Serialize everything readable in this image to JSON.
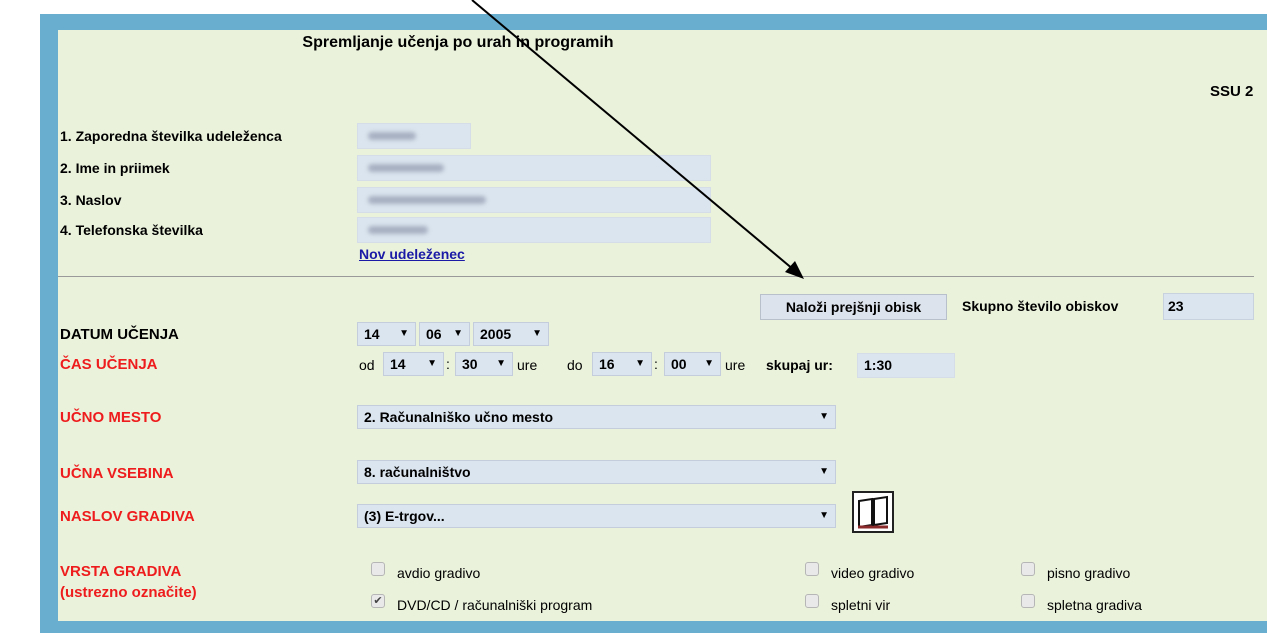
{
  "form": {
    "title": "Spremljanje učenja po urah in programih",
    "code": "SSU 2"
  },
  "participant": {
    "fields": [
      {
        "label": "1. Zaporedna številka udeleženca"
      },
      {
        "label": "2. Ime in priimek"
      },
      {
        "label": "3. Naslov"
      },
      {
        "label": "4. Telefonska številka"
      }
    ],
    "new_link": "Nov udeleženec"
  },
  "visits": {
    "load_button": "Naloži prejšnji obisk",
    "count_label": "Skupno število obiskov",
    "count_value": "23"
  },
  "date": {
    "label": "DATUM UČENJA",
    "day": "14",
    "month": "06",
    "year": "2005"
  },
  "time": {
    "label": "ČAS UČENJA",
    "from_label": "od",
    "from_hour": "14",
    "from_minute": "30",
    "hours_word": "ure",
    "to_label": "do",
    "to_hour": "16",
    "to_minute": "00",
    "colon": ":",
    "total_label": "skupaj ur:",
    "total_value": "1:30"
  },
  "place": {
    "label": "UČNO MESTO",
    "value": "2.  Računalniško učno mesto"
  },
  "content": {
    "label": "UČNA VSEBINA",
    "value": "8.  računalništvo"
  },
  "material": {
    "label": "NASLOV GRADIVA",
    "value": "(3)  E-trgov..."
  },
  "type": {
    "label": "VRSTA GRADIVA",
    "sublabel": "(ustrezno označite)",
    "options": [
      {
        "label": "avdio gradivo",
        "checked": false
      },
      {
        "label": "video gradivo",
        "checked": false
      },
      {
        "label": "pisno gradivo",
        "checked": false
      },
      {
        "label": "DVD/CD / računalniški program",
        "checked": true
      },
      {
        "label": "spletni vir",
        "checked": false
      },
      {
        "label": "spletna gradiva",
        "checked": false
      }
    ]
  },
  "icons": {
    "dropdown": "▼",
    "check": "✔",
    "book": "book-icon",
    "arrow": "annotation-arrow"
  },
  "colors": {
    "required_label": "#ee1c1c",
    "panel": "#eaf2dc",
    "frame": "#6aaecf",
    "link": "#1a1aa6"
  }
}
